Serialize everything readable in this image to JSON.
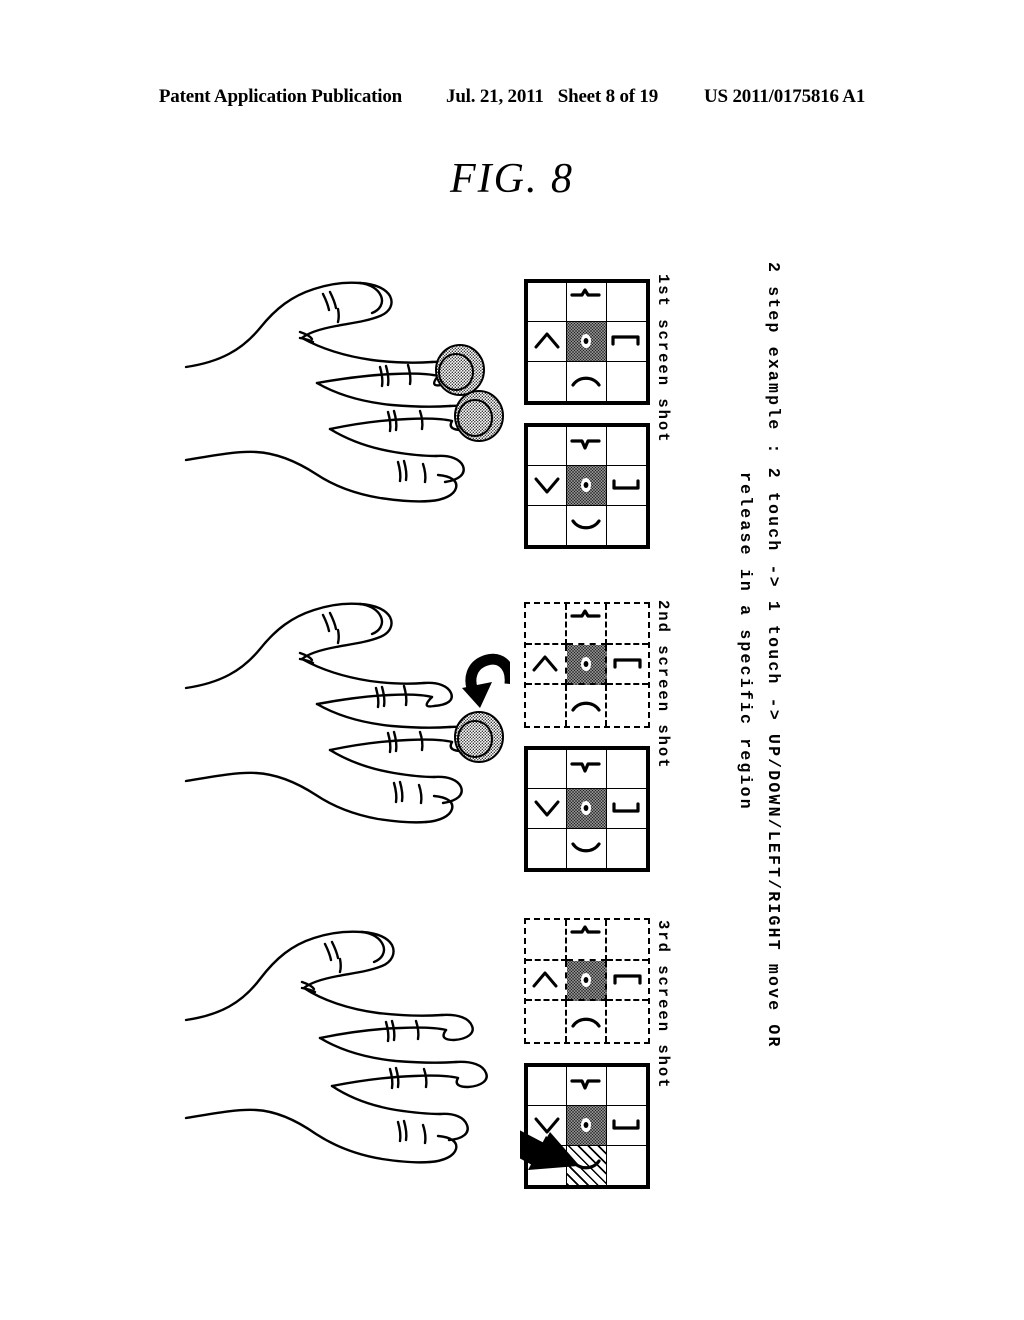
{
  "header": {
    "publication": "Patent Application Publication",
    "date": "Jul. 21, 2011",
    "sheet": "Sheet 8 of 19",
    "doc_number": "US 2011/0175816 A1"
  },
  "figure": {
    "title": "FIG. 8",
    "caption_line_1": "2 step example : 2 touch -> 1 touch -> UP/DOWN/LEFT/RIGHT move OR",
    "caption_line_2": "release in a specific region"
  },
  "colors": {
    "ink": "#000000",
    "paper": "#ffffff",
    "stipple": "#1a1a1a"
  },
  "panels": [
    {
      "label": "1st screen shot",
      "hand": {
        "name": "hand-back-view",
        "touch_points": 2,
        "touch_point_names": [
          "touch-indicator-index",
          "touch-indicator-ring"
        ],
        "arrow": "none"
      },
      "screens": [
        {
          "name": "screen-grid-upper",
          "border": "solid",
          "center_fill": "stipple",
          "glyphs": {
            "top_center": "bracket-up",
            "middle_left": "chevron-up",
            "middle_center": "dot-cursor",
            "middle_right": "bracket-right",
            "bottom_center": "arc-down"
          }
        },
        {
          "name": "screen-grid-lower",
          "border": "solid",
          "center_fill": "stipple",
          "glyphs": {
            "top_center": "bracket-down",
            "middle_left": "chevron-down",
            "middle_center": "dot-cursor",
            "middle_right": "bracket-left",
            "bottom_center": "arc-up"
          }
        }
      ]
    },
    {
      "label": "2nd screen shot",
      "hand": {
        "name": "hand-back-view",
        "touch_points": 1,
        "touch_point_names": [
          "touch-indicator-ring"
        ],
        "arrow": "curved-release-arrow"
      },
      "screens": [
        {
          "name": "screen-grid-upper",
          "border": "dashed",
          "center_fill": "stipple",
          "glyphs": {
            "top_center": "bracket-up",
            "middle_left": "chevron-up",
            "middle_center": "dot-cursor",
            "middle_right": "bracket-right",
            "bottom_center": "arc-down"
          }
        },
        {
          "name": "screen-grid-lower",
          "border": "solid",
          "center_fill": "stipple",
          "glyphs": {
            "top_center": "bracket-down",
            "middle_left": "chevron-down",
            "middle_center": "dot-cursor",
            "middle_right": "bracket-left",
            "bottom_center": "arc-up"
          }
        }
      ]
    },
    {
      "label": "3rd screen shot",
      "hand": {
        "name": "hand-back-view",
        "touch_points": 0,
        "touch_point_names": [],
        "arrow": "none"
      },
      "screens": [
        {
          "name": "screen-grid-upper",
          "border": "dashed",
          "center_fill": "stipple",
          "glyphs": {
            "top_center": "bracket-up",
            "middle_left": "chevron-up",
            "middle_center": "dot-cursor",
            "middle_right": "bracket-right",
            "bottom_center": "arc-down"
          }
        },
        {
          "name": "screen-grid-lower",
          "border": "solid",
          "center_fill": "stipple",
          "release_region_fill": "diagonal-hatch",
          "release_region_cell": "bottom_center",
          "move_arrow": "thick-move-arrow",
          "glyphs": {
            "top_center": "bracket-down",
            "middle_left": "chevron-down",
            "middle_center": "dot-cursor",
            "middle_right": "bracket-left",
            "bottom_center": "arc-up"
          }
        }
      ]
    }
  ]
}
